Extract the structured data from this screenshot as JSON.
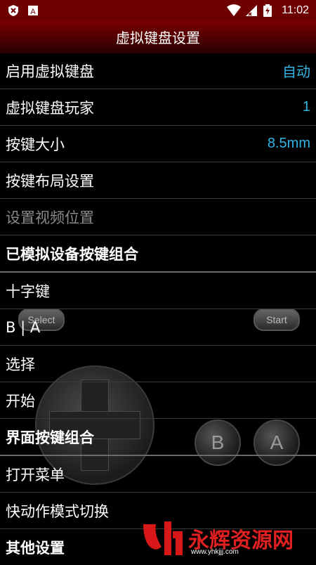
{
  "status_bar": {
    "time": "11:02",
    "notif_a_letter": "A"
  },
  "title": "虚拟键盘设置",
  "rows": [
    {
      "label": "启用虚拟键盘",
      "value": "自动"
    },
    {
      "label": "虚拟键盘玩家",
      "value": "1"
    },
    {
      "label": "按键大小",
      "value": "8.5mm"
    },
    {
      "label": "按键布局设置"
    },
    {
      "label": "设置视频位置"
    },
    {
      "label": "已模拟设备按键组合"
    },
    {
      "label": "十字键"
    },
    {
      "label": "B | A"
    },
    {
      "label": "选择"
    },
    {
      "label": "开始"
    },
    {
      "label": "界面按键组合"
    },
    {
      "label": "打开菜单"
    },
    {
      "label": "快动作模式切换"
    },
    {
      "label": "其他设置"
    }
  ],
  "overlay": {
    "select_label": "Select",
    "start_label": "Start",
    "b_label": "B",
    "a_label": "A"
  },
  "watermark": {
    "text": "永辉资源网",
    "url": "www.yhkjjj.com"
  }
}
